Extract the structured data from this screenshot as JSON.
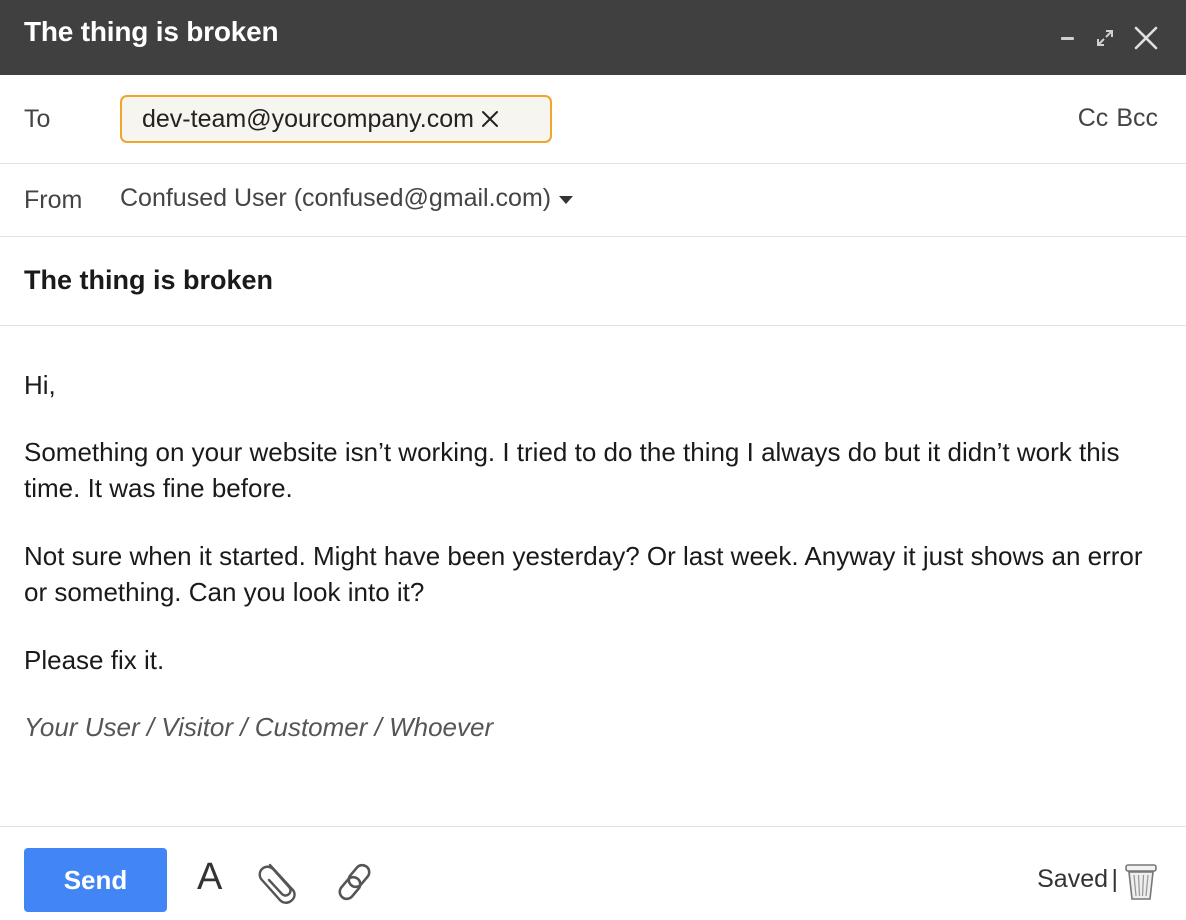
{
  "window": {
    "title": "The thing is broken",
    "controls": {
      "minimize": "minimize-icon",
      "expand": "expand-icon",
      "close": "close-icon"
    }
  },
  "to": {
    "label": "To",
    "recipient": "dev-team@yourcompany.com",
    "cc_label": "Cc",
    "bcc_label": "Bcc"
  },
  "from": {
    "label": "From",
    "value": "Confused User (confused@gmail.com)"
  },
  "subject": "The thing is broken",
  "message": {
    "greeting": "Hi,",
    "paragraph1": "Something on your website isn’t working. I tried to do the thing I always do but it didn’t work this time. It was fine before.",
    "paragraph2": "Not sure when it started. Might have been yesterday? Or last week. Anyway it just shows an error or something. Can you look into it?",
    "paragraph3": "Please fix it.",
    "signature": "Your User / Visitor / Customer / Whoever"
  },
  "footer": {
    "send_label": "Send",
    "format_label": "A",
    "status": "Saved",
    "separator": "|"
  },
  "colors": {
    "titlebar": "#404040",
    "send_button": "#4285f4",
    "chip_border": "#f0a52b"
  }
}
